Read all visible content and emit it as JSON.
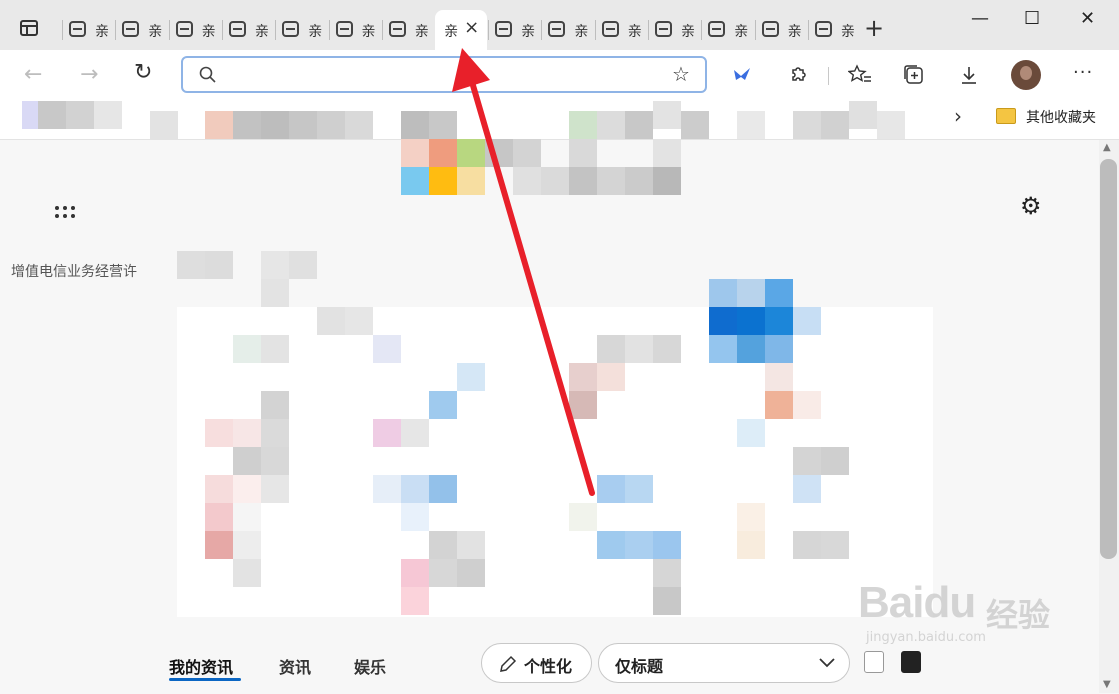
{
  "tabs": {
    "inactive_glyph": "亲",
    "count_before_active": 7,
    "count_after_active": 7,
    "active_close": "×",
    "new_tab": "+"
  },
  "window_controls": {
    "minimize": "—",
    "maximize": "☐",
    "close": "✕"
  },
  "toolbar": {
    "back": "←",
    "forward": "→",
    "refresh": "↻",
    "search_icon": "search-icon",
    "address_value": "",
    "favorite_add": "☆"
  },
  "favorites_bar": {
    "chevron": "›",
    "other_favorites": "其他收藏夹"
  },
  "content": {
    "license_text": "增值电信业务经营许",
    "settings_icon": "⚙"
  },
  "bottom_nav": {
    "tabs": [
      "我的资讯",
      "资讯",
      "娱乐"
    ],
    "personalize": "个性化",
    "dropdown_value": "仅标题",
    "dropdown_chevron": "⌄"
  },
  "watermark": {
    "brand": "Baidu",
    "cn": "经验",
    "url": "jingyan.baidu.com"
  },
  "colors": {
    "accent_underline": "#0b66c3",
    "arrow": "#e8202a",
    "address_border": "#8fb4e6"
  }
}
